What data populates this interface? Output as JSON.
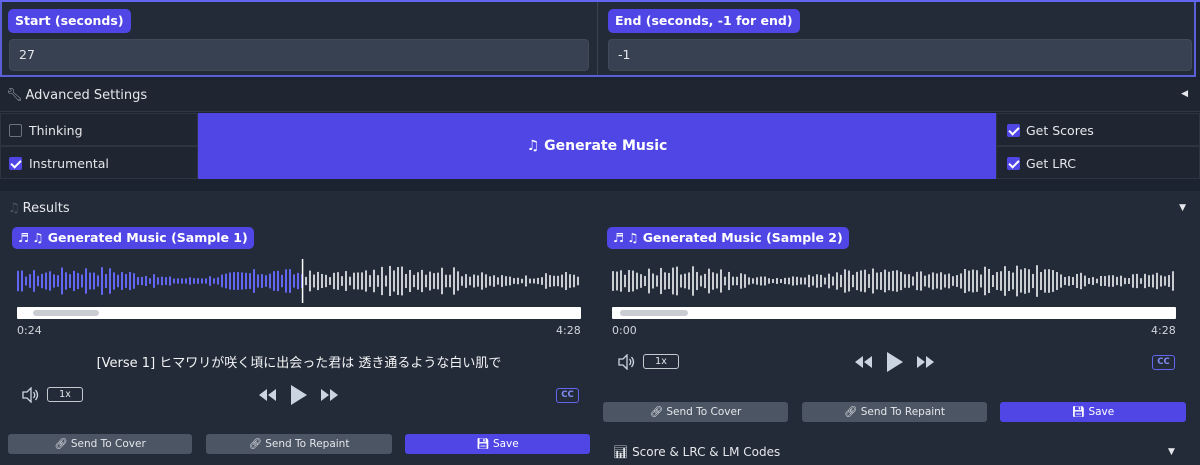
{
  "timing": {
    "start_label": "Start (seconds)",
    "start_value": "27",
    "end_label": "End (seconds, -1 for end)",
    "end_value": "-1"
  },
  "advanced": {
    "title": "Advanced Settings",
    "icon": "wrench-icon"
  },
  "options": {
    "thinking": {
      "label": "Thinking",
      "checked": false
    },
    "instrumental": {
      "label": "Instrumental",
      "checked": true
    },
    "get_scores": {
      "label": "Get Scores",
      "checked": true
    },
    "get_lrc": {
      "label": "Get LRC",
      "checked": true
    }
  },
  "generate_button": "♫ Generate Music",
  "results": {
    "title": "Results",
    "samples": [
      {
        "label": "♫ Generated Music (Sample 1)",
        "current_time": "0:24",
        "duration": "4:28",
        "progress": 0.505,
        "speed": "1x",
        "lyric": "[Verse 1] ヒマワリが咲く頃に出会った君は 透き通るような白い肌で",
        "send_cover": "Send To Cover",
        "send_repaint": "Send To Repaint",
        "save": "Save"
      },
      {
        "label": "♫ Generated Music (Sample 2)",
        "current_time": "0:00",
        "duration": "4:28",
        "progress": 0,
        "speed": "1x",
        "send_cover": "Send To Cover",
        "send_repaint": "Send To Repaint",
        "save": "Save"
      }
    ],
    "cc_label": "CC",
    "score_section": "Score & LRC & LM Codes"
  },
  "colors": {
    "accent": "#4f46e5",
    "played": "#6366f1",
    "unplayed": "#c9ccd1",
    "background": "#1c2330"
  }
}
